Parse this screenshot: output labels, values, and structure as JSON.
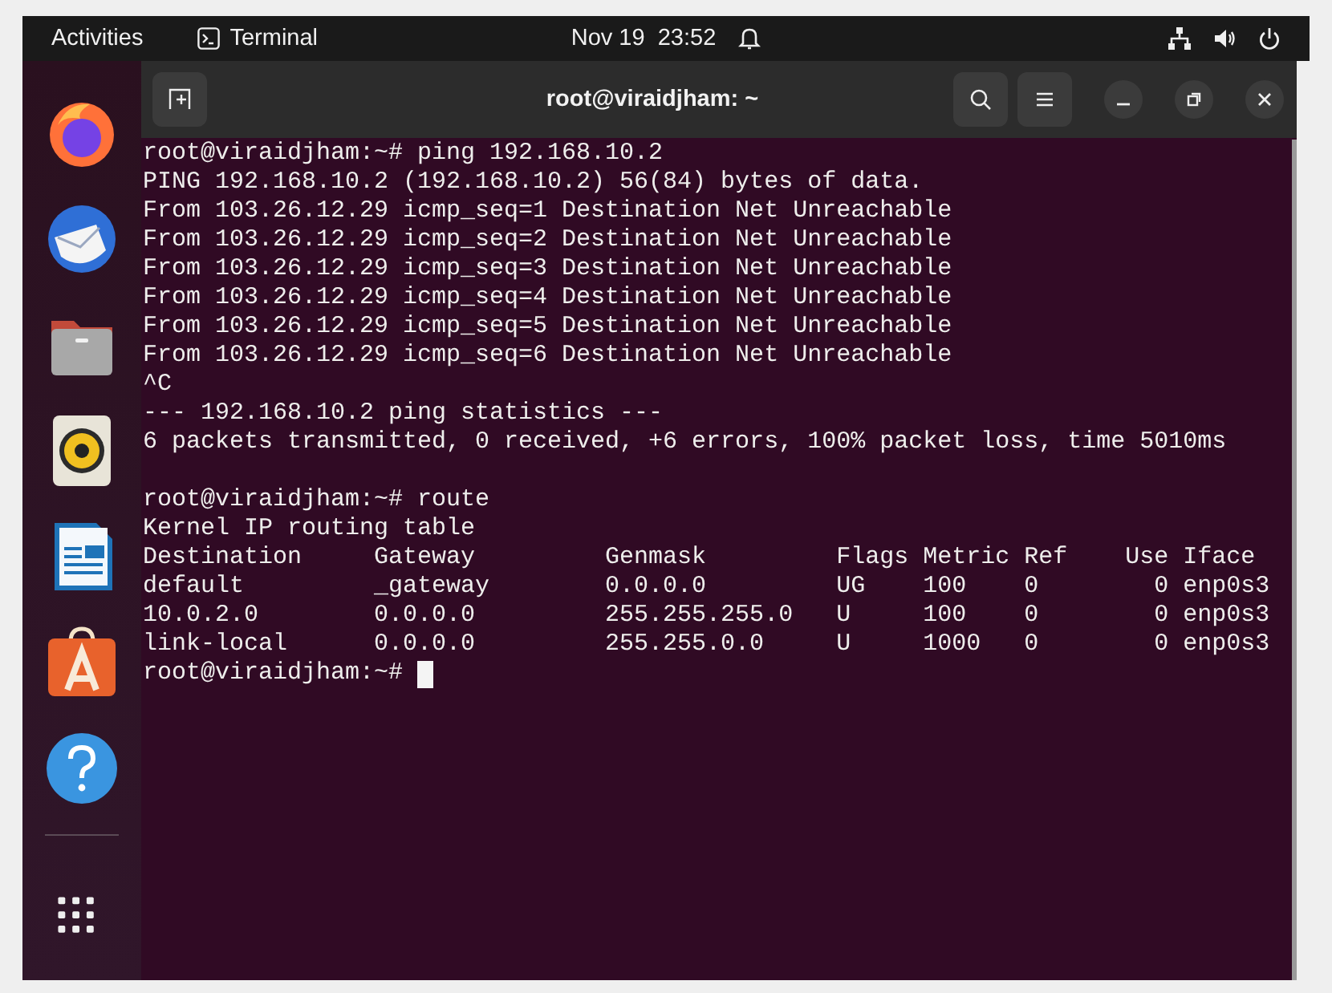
{
  "top_bar": {
    "activities": "Activities",
    "app_name": "Terminal",
    "clock": "Nov 19  23:52"
  },
  "dock": {
    "items": [
      {
        "kind": "browser"
      },
      {
        "kind": "mail"
      },
      {
        "kind": "files"
      },
      {
        "kind": "music"
      },
      {
        "kind": "writer"
      },
      {
        "kind": "store"
      },
      {
        "kind": "help"
      }
    ]
  },
  "window": {
    "title": "root@viraidjham: ~"
  },
  "terminal": {
    "lines": [
      {
        "kind": "text",
        "text": "root@viraidjham:~# ping 192.168.10.2"
      },
      {
        "kind": "text",
        "text": "PING 192.168.10.2 (192.168.10.2) 56(84) bytes of data."
      },
      {
        "kind": "text",
        "text": "From 103.26.12.29 icmp_seq=1 Destination Net Unreachable"
      },
      {
        "kind": "text",
        "text": "From 103.26.12.29 icmp_seq=2 Destination Net Unreachable"
      },
      {
        "kind": "text",
        "text": "From 103.26.12.29 icmp_seq=3 Destination Net Unreachable"
      },
      {
        "kind": "text",
        "text": "From 103.26.12.29 icmp_seq=4 Destination Net Unreachable"
      },
      {
        "kind": "text",
        "text": "From 103.26.12.29 icmp_seq=5 Destination Net Unreachable"
      },
      {
        "kind": "text",
        "text": "From 103.26.12.29 icmp_seq=6 Destination Net Unreachable"
      },
      {
        "kind": "text",
        "text": "^C"
      },
      {
        "kind": "text",
        "text": "--- 192.168.10.2 ping statistics ---"
      },
      {
        "kind": "text",
        "text": "6 packets transmitted, 0 received, +6 errors, 100% packet loss, time 5010ms"
      },
      {
        "kind": "blank"
      },
      {
        "kind": "text",
        "text": "root@viraidjham:~# route"
      },
      {
        "kind": "text",
        "text": "Kernel IP routing table"
      },
      {
        "kind": "text",
        "text": "Destination     Gateway         Genmask         Flags Metric Ref    Use Iface"
      },
      {
        "kind": "text",
        "text": "default         _gateway        0.0.0.0         UG    100    0        0 enp0s3"
      },
      {
        "kind": "text",
        "text": "10.0.2.0        0.0.0.0         255.255.255.0   U     100    0        0 enp0s3"
      },
      {
        "kind": "text",
        "text": "link-local      0.0.0.0         255.255.0.0     U     1000   0        0 enp0s3"
      },
      {
        "kind": "prompt",
        "text": "root@viraidjham:~#"
      }
    ]
  }
}
